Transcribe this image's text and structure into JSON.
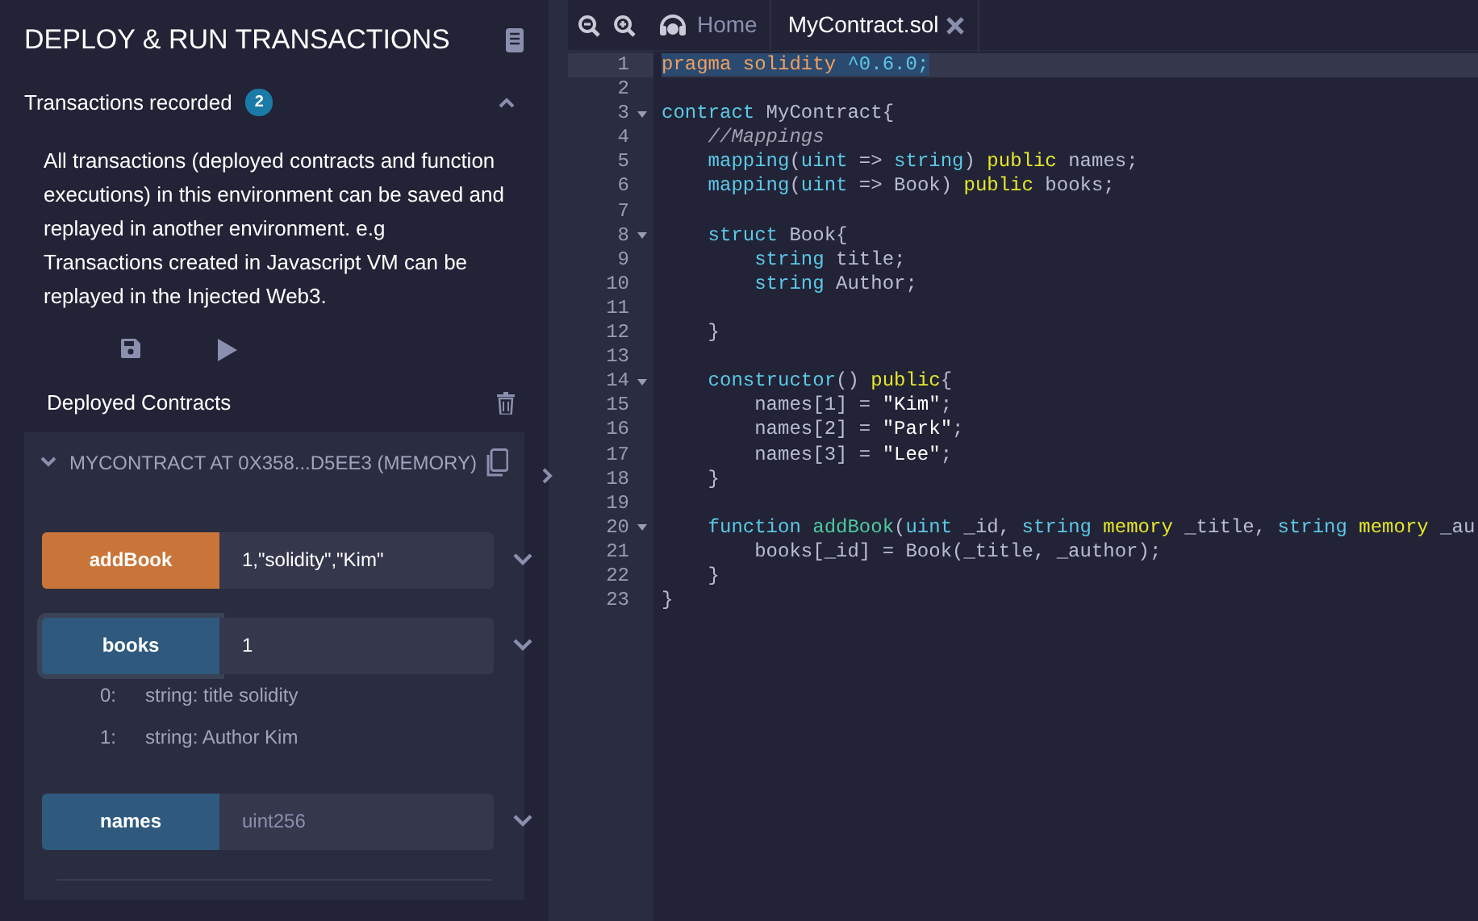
{
  "panel": {
    "title": "DEPLOY & RUN TRANSACTIONS",
    "recorded": {
      "label": "Transactions recorded",
      "count": "2",
      "expanded": true,
      "description": "All transactions (deployed contracts and function executions) in this environment can be saved and replayed in another environment. e.g Transactions created in Javascript VM can be replayed in the Injected Web3."
    },
    "deployed": {
      "label": "Deployed Contracts",
      "contract": {
        "title": "MYCONTRACT AT 0X358...D5EE3 (MEMORY)",
        "expanded": true,
        "functions": [
          {
            "name": "addBook",
            "kind": "transact",
            "value": "1,\"solidity\",\"Kim\"",
            "focused": false
          },
          {
            "name": "books",
            "kind": "call",
            "value": "1",
            "focused": true,
            "outputs": [
              {
                "index": "0:",
                "value": "string: title solidity"
              },
              {
                "index": "1:",
                "value": "string: Author Kim"
              }
            ]
          },
          {
            "name": "names",
            "kind": "call",
            "placeholder": "uint256",
            "focused": false
          }
        ]
      }
    }
  },
  "editor": {
    "tabs": [
      {
        "label": "Home",
        "kind": "home",
        "selected": false
      },
      {
        "label": "MyContract.sol",
        "kind": "file",
        "selected": true
      }
    ],
    "lines": [
      {
        "number": "1",
        "foldable": false,
        "selected": true,
        "tokens": [
          {
            "t": "pragma solidity",
            "kind": "pr"
          },
          {
            "t": " ^0.6.0;",
            "kind": "kw"
          }
        ]
      },
      {
        "number": "2",
        "foldable": false,
        "selected": false
      },
      {
        "number": "3",
        "foldable": true,
        "selected": false,
        "tokens": [
          {
            "t": "contract",
            "kind": "kw"
          },
          {
            "t": " MyContract{",
            "kind": "id"
          }
        ]
      },
      {
        "number": "4",
        "foldable": false,
        "selected": false,
        "tokens": [
          {
            "t": "    //Mappings",
            "kind": "cm"
          }
        ]
      },
      {
        "number": "5",
        "foldable": false,
        "selected": false,
        "tokens": [
          {
            "t": "    mapping",
            "kind": "kw"
          },
          {
            "t": "(",
            "kind": "id"
          },
          {
            "t": "uint",
            "kind": "kw"
          },
          {
            "t": " => ",
            "kind": "id"
          },
          {
            "t": "string",
            "kind": "kw"
          },
          {
            "t": ") ",
            "kind": "id"
          },
          {
            "t": "public",
            "kind": "mod"
          },
          {
            "t": " names;",
            "kind": "id"
          }
        ]
      },
      {
        "number": "6",
        "foldable": false,
        "selected": false,
        "tokens": [
          {
            "t": "    mapping",
            "kind": "kw"
          },
          {
            "t": "(",
            "kind": "id"
          },
          {
            "t": "uint",
            "kind": "kw"
          },
          {
            "t": " => Book) ",
            "kind": "id"
          },
          {
            "t": "public",
            "kind": "mod"
          },
          {
            "t": " books;",
            "kind": "id"
          }
        ]
      },
      {
        "number": "7",
        "foldable": false,
        "selected": false
      },
      {
        "number": "8",
        "foldable": true,
        "selected": false,
        "tokens": [
          {
            "t": "    struct",
            "kind": "kw"
          },
          {
            "t": " Book{",
            "kind": "id"
          }
        ]
      },
      {
        "number": "9",
        "foldable": false,
        "selected": false,
        "tokens": [
          {
            "t": "        string",
            "kind": "kw"
          },
          {
            "t": " title;",
            "kind": "id"
          }
        ]
      },
      {
        "number": "10",
        "foldable": false,
        "selected": false,
        "tokens": [
          {
            "t": "        string",
            "kind": "kw"
          },
          {
            "t": " Author;",
            "kind": "id"
          }
        ]
      },
      {
        "number": "11",
        "foldable": false,
        "selected": false
      },
      {
        "number": "12",
        "foldable": false,
        "selected": false,
        "tokens": [
          {
            "t": "    }",
            "kind": "id"
          }
        ]
      },
      {
        "number": "13",
        "foldable": false,
        "selected": false
      },
      {
        "number": "14",
        "foldable": true,
        "selected": false,
        "tokens": [
          {
            "t": "    constructor",
            "kind": "kw"
          },
          {
            "t": "() ",
            "kind": "id"
          },
          {
            "t": "public",
            "kind": "mod"
          },
          {
            "t": "{",
            "kind": "id"
          }
        ]
      },
      {
        "number": "15",
        "foldable": false,
        "selected": false,
        "tokens": [
          {
            "t": "        names[1] = ",
            "kind": "id"
          },
          {
            "t": "\"Kim\"",
            "kind": "str"
          },
          {
            "t": ";",
            "kind": "id"
          }
        ]
      },
      {
        "number": "16",
        "foldable": false,
        "selected": false,
        "tokens": [
          {
            "t": "        names[2] = ",
            "kind": "id"
          },
          {
            "t": "\"Park\"",
            "kind": "str"
          },
          {
            "t": ";",
            "kind": "id"
          }
        ]
      },
      {
        "number": "17",
        "foldable": false,
        "selected": false,
        "tokens": [
          {
            "t": "        names[3] = ",
            "kind": "id"
          },
          {
            "t": "\"Lee\"",
            "kind": "str"
          },
          {
            "t": ";",
            "kind": "id"
          }
        ]
      },
      {
        "number": "18",
        "foldable": false,
        "selected": false,
        "tokens": [
          {
            "t": "    }",
            "kind": "id"
          }
        ]
      },
      {
        "number": "19",
        "foldable": false,
        "selected": false
      },
      {
        "number": "20",
        "foldable": true,
        "selected": false,
        "tokens": [
          {
            "t": "    function",
            "kind": "kw"
          },
          {
            "t": " addBook",
            "kind": "fn"
          },
          {
            "t": "(",
            "kind": "id"
          },
          {
            "t": "uint",
            "kind": "kw"
          },
          {
            "t": " _id, ",
            "kind": "id"
          },
          {
            "t": "string",
            "kind": "kw"
          },
          {
            "t": " memory",
            "kind": "mod"
          },
          {
            "t": " _title, ",
            "kind": "id"
          },
          {
            "t": "string",
            "kind": "kw"
          },
          {
            "t": " memory",
            "kind": "mod"
          },
          {
            "t": " _au",
            "kind": "id"
          }
        ]
      },
      {
        "number": "21",
        "foldable": false,
        "selected": false,
        "tokens": [
          {
            "t": "        books[_id] = Book(_title, _author);",
            "kind": "id"
          }
        ]
      },
      {
        "number": "22",
        "foldable": false,
        "selected": false,
        "tokens": [
          {
            "t": "    }",
            "kind": "id"
          }
        ]
      },
      {
        "number": "23",
        "foldable": false,
        "selected": false,
        "tokens": [
          {
            "t": "}",
            "kind": "id"
          }
        ]
      }
    ]
  }
}
